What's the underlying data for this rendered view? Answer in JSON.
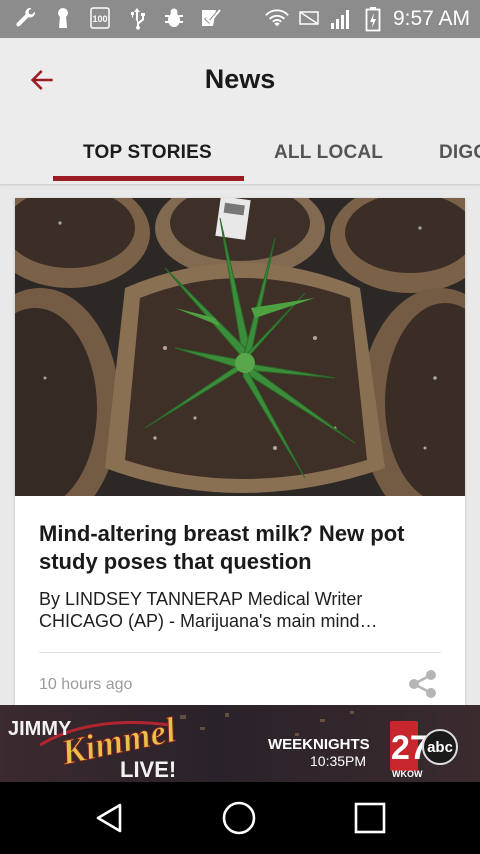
{
  "status_bar": {
    "time": "9:57 AM",
    "left_icons": [
      "wrench-icon",
      "keyhole-icon",
      "badge-100-icon",
      "usb-icon",
      "bug-icon",
      "checkbox-icon"
    ],
    "badge_text": "100",
    "right_icons": [
      "wifi-icon",
      "no-sim-icon",
      "signal-icon",
      "battery-icon"
    ]
  },
  "header": {
    "title": "News",
    "back_icon": "arrow-left-icon",
    "accent_color": "#9c1b22"
  },
  "tabs": [
    {
      "label": "TOP STORIES",
      "active": true
    },
    {
      "label": "ALL LOCAL",
      "active": false
    },
    {
      "label": "DIGG",
      "active": false
    }
  ],
  "story": {
    "image": "cannabis-seedling-in-peat-pot-photo",
    "headline": "Mind-altering breast milk? New pot study poses that question",
    "snippet": "By LINDSEY TANNERAP Medical Writer CHICAGO (AP) - Marijuana's main mind…",
    "time_ago": "10 hours ago",
    "share_icon": "share-icon"
  },
  "ad": {
    "show_top": "JIMMY",
    "show_name": "Kimmel",
    "show_bottom": "LIVE!",
    "schedule": "WEEKNIGHTS",
    "air_time": "10:35PM",
    "channel_number": "27",
    "network": "abc",
    "station": "WKOW"
  },
  "nav_bar": {
    "buttons": [
      "back-triangle-icon",
      "home-circle-icon",
      "recents-square-icon"
    ]
  }
}
